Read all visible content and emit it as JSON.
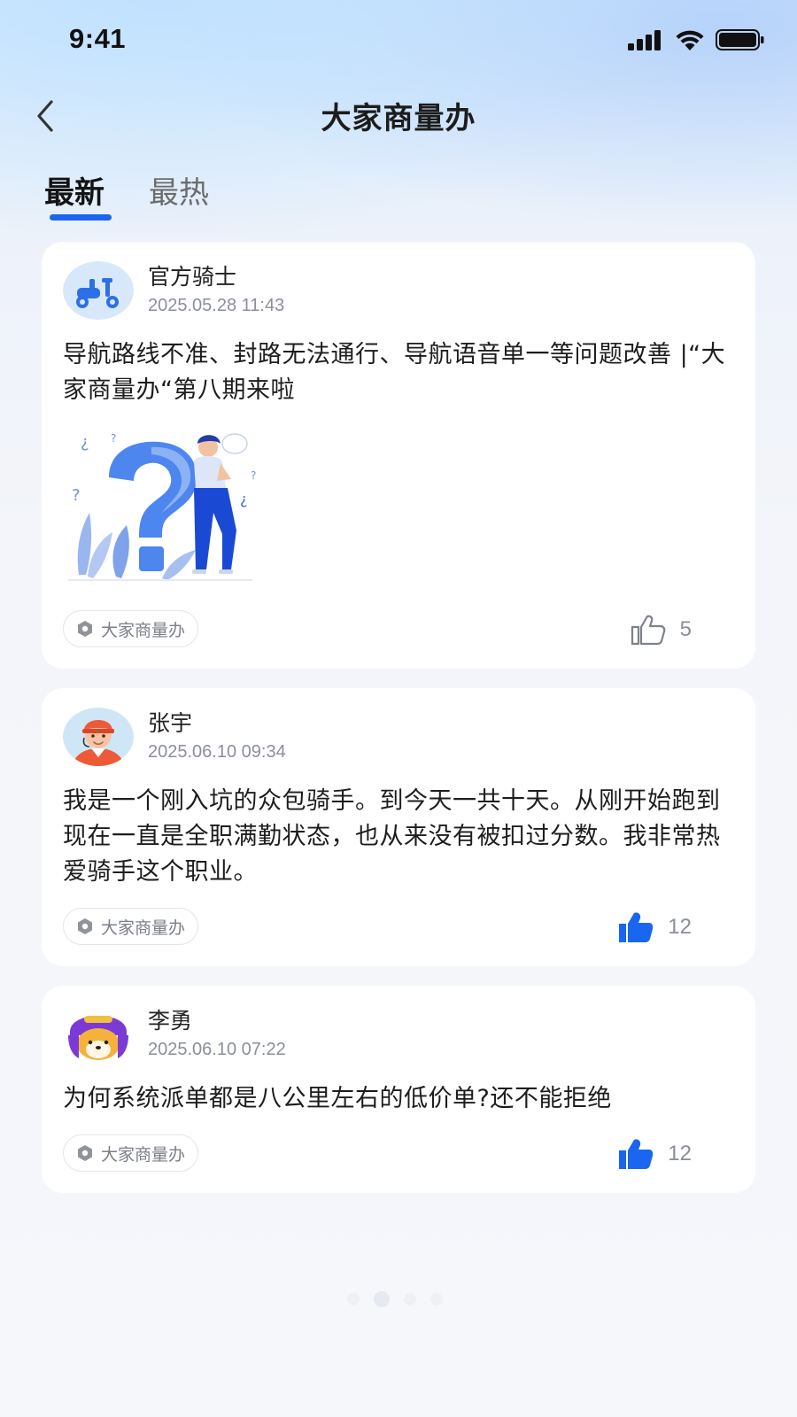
{
  "status_bar": {
    "time": "9:41"
  },
  "header": {
    "title": "大家商量办",
    "back_icon": "chevron-left-icon"
  },
  "tabs": [
    {
      "label": "最新",
      "active": true
    },
    {
      "label": "最热",
      "active": false
    }
  ],
  "colors": {
    "accent": "#1a66f0",
    "like_active": "#1a66f0",
    "card_bg": "#ffffff"
  },
  "posts": [
    {
      "author": "官方骑士",
      "avatar": "scooter-avatar",
      "time": "2025.05.28  11:43",
      "content": "导航路线不准、封路无法通行、导航语音单一等问题改善 |“大家商量办“第八期来啦",
      "has_image": true,
      "image": "question-mark-illustration",
      "tag": "大家商量办",
      "likes": "5",
      "liked": false
    },
    {
      "author": "张宇",
      "avatar": "courier-avatar",
      "time": "2025.06.10  09:34",
      "content": "我是一个刚入坑的众包骑手。到今天一共十天。从刚开始跑到现在一直是全职满勤状态，也从来没有被扣过分数。我非常热爱骑手这个职业。",
      "has_image": false,
      "tag": "大家商量办",
      "likes": "12",
      "liked": true
    },
    {
      "author": "李勇",
      "avatar": "shiba-rider-avatar",
      "time": "2025.06.10  07:22",
      "content": "为何系统派单都是八公里左右的低价单?还不能拒绝",
      "has_image": false,
      "tag": "大家商量办",
      "likes": "12",
      "liked": true
    }
  ]
}
